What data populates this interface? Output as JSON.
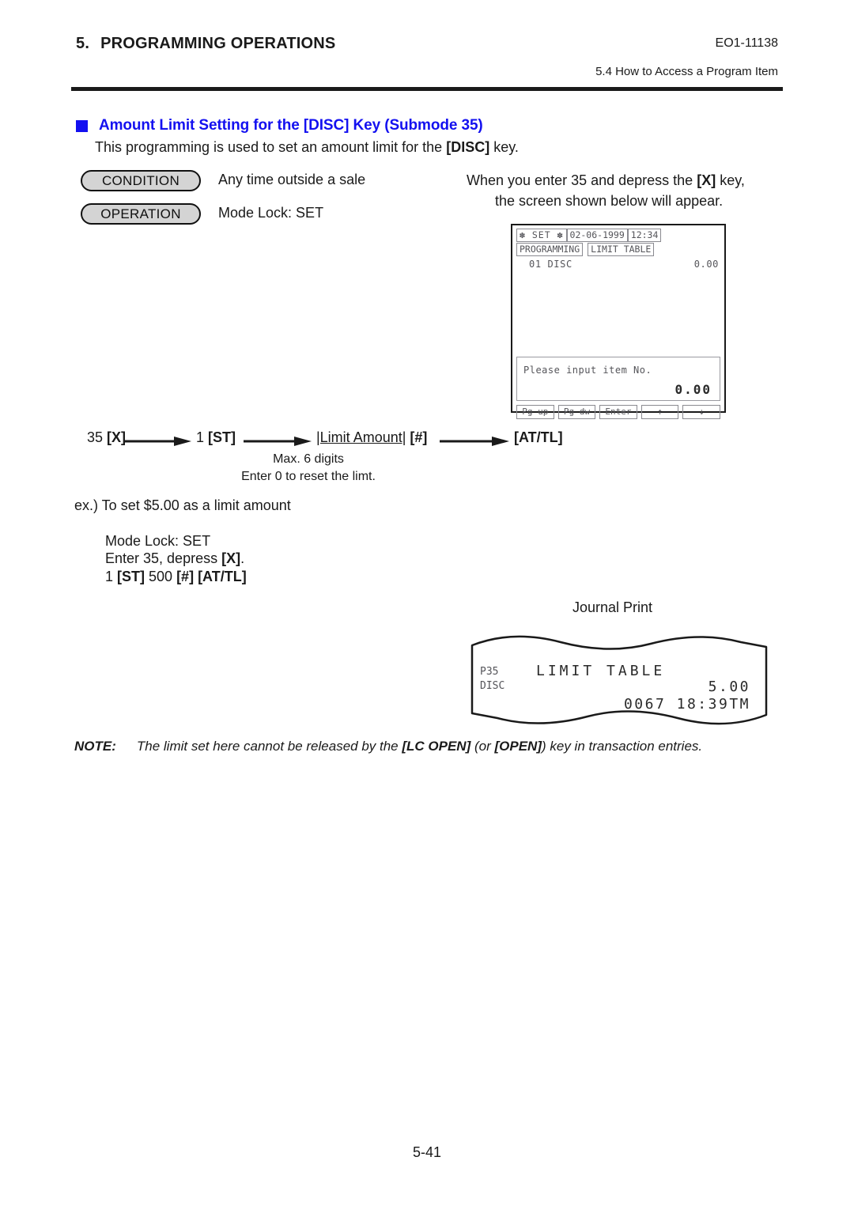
{
  "header": {
    "section_number": "5.",
    "section_title": "PROGRAMMING OPERATIONS",
    "doc_code": "EO1-11138",
    "subsection": "5.4  How to Access a Program Item"
  },
  "title": {
    "heading": "Amount Limit Setting for the [DISC] Key (Submode 35)",
    "subtitle_pre": "This programming is used to set an amount limit for the ",
    "subtitle_key": "[DISC]",
    "subtitle_post": " key.",
    "accent_color": "#1310f0"
  },
  "pills": {
    "condition_label": "CONDITION",
    "condition_desc": "Any time outside a sale",
    "operation_label": "OPERATION",
    "operation_desc": "Mode Lock:  SET"
  },
  "intro": {
    "line1_pre": "When you enter 35 and depress the ",
    "line1_key": "[X]",
    "line1_post": " key,",
    "line2": "the screen shown below will appear."
  },
  "lcd": {
    "mode": "SET",
    "mode_star": "✽",
    "date": "02-06-1999",
    "time": "12:34",
    "tag_programming": "PROGRAMMING",
    "tag_table": "LIMIT TABLE",
    "item_label": "01 DISC",
    "item_value": "0.00",
    "message": "Please input item No.",
    "amount": "0.00",
    "keys": [
      "Pg up",
      "Pg dw",
      "Enter",
      "↑",
      "↓"
    ]
  },
  "flow": {
    "step1_num": "35",
    "step1_key": "[X]",
    "step2_num": "1",
    "step2_key": "[ST]",
    "step3_field": "|Limit Amount|",
    "step3_key": "[#]",
    "step4_key": "[AT/TL]",
    "note_line1": "Max. 6 digits",
    "note_line2": "Enter 0 to reset the limt."
  },
  "example": {
    "title": "ex.)  To set $5.00 as a limit amount",
    "line1": "Mode Lock:  SET",
    "line2_pre": "Enter 35, depress ",
    "line2_key": "[X]",
    "line2_post": ".",
    "line3_a": "1 ",
    "line3_b": "[ST]",
    "line3_c": "  500 ",
    "line3_d": "[#]",
    "line3_e": "  [AT/TL]"
  },
  "journal": {
    "label": "Journal Print",
    "program_code": "P35",
    "title": "LIMIT TABLE",
    "item": "DISC",
    "amount": "5.00",
    "footer": "0067 18:39TM"
  },
  "note": {
    "label": "NOTE:",
    "text_pre": "The limit set here cannot be released by the ",
    "key1": "[LC OPEN]",
    "text_mid": " (or ",
    "key2": "[OPEN]",
    "text_post": ") key in transaction entries."
  },
  "footer": {
    "page_number": "5-41"
  }
}
